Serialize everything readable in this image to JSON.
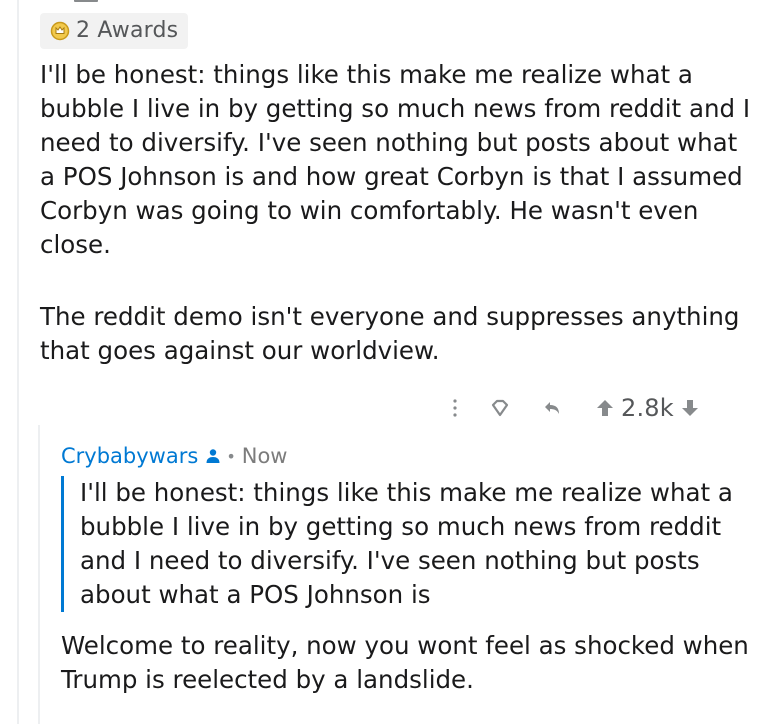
{
  "parent_comment": {
    "awards_label": "2 Awards",
    "body_paragraphs": [
      "I'll be honest: things like this make me realize what a bubble I live in by getting so much news from reddit and I need to diversify.  I've seen nothing but posts about what a POS Johnson is and how great Corbyn is that I assumed Corbyn was going to win comfortably. He wasn't even close.",
      "The reddit demo isn't everyone and suppresses anything that goes against our worldview."
    ],
    "actions": {
      "score": "2.8k"
    }
  },
  "reply_comment": {
    "username": "Crybabywars",
    "separator": "•",
    "time": "Now",
    "quote": "I'll be honest: things like this make me realize what a bubble I live in by getting so much news from reddit and I need to diversify. I've seen nothing but posts about what a POS Johnson is",
    "body": "Welcome to reality, now you wont feel as shocked when Trump is reelected by a landslide."
  },
  "colors": {
    "username": "#0079d3",
    "quote_border": "#0079d3",
    "meta_gray": "#878a8c",
    "award_gold": "#d9a020"
  },
  "icons": [
    "award-icon",
    "more-options-icon",
    "give-award-icon",
    "reply-icon",
    "upvote-icon",
    "downvote-icon",
    "op-user-icon"
  ]
}
